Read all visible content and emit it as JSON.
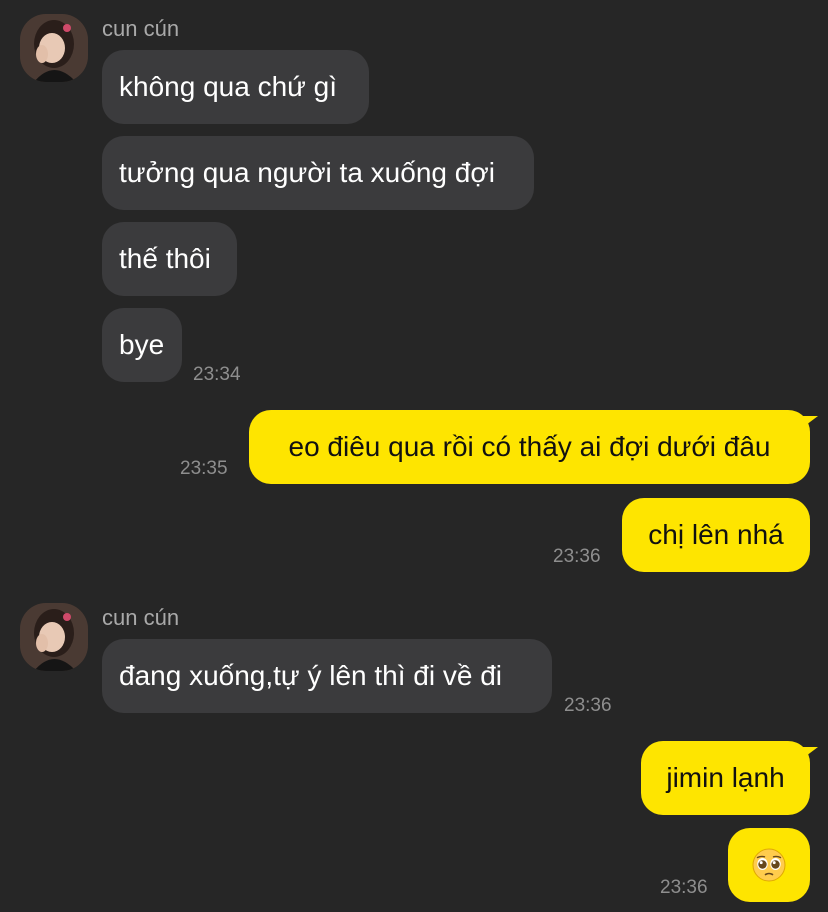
{
  "conversation": {
    "group1": {
      "sender": "cun cún",
      "messages": [
        "không qua chứ gì",
        "tưởng qua người ta xuống đợi",
        "thế thôi",
        "bye"
      ],
      "time": "23:34"
    },
    "out1": {
      "text": "eo điêu qua rồi có thấy ai đợi dưới đâu",
      "time": "23:35"
    },
    "out2": {
      "text": "chị lên nhá",
      "time": "23:36"
    },
    "group2": {
      "sender": "cun cún",
      "messages": [
        "đang xuống,tự ý lên thì đi về đi"
      ],
      "time": "23:36"
    },
    "out3": {
      "text": "jimin lạnh"
    },
    "out4": {
      "emoji": "pleading-face-emoji",
      "time": "23:36"
    }
  },
  "colors": {
    "background": "#262626",
    "incoming_bubble": "#3b3b3d",
    "outgoing_bubble": "#fee500",
    "timestamp": "#8e8e8e",
    "sender_name": "#a9a9a9"
  }
}
